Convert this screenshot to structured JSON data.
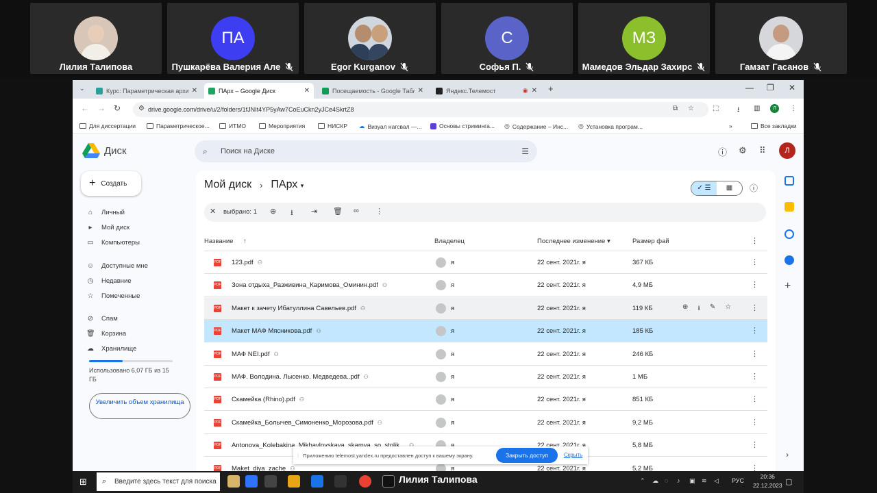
{
  "participants": [
    {
      "name": "Лилия Талипова",
      "muted": false,
      "avatar_type": "photo",
      "avatar_text": ""
    },
    {
      "name": "Пушкарёва Валерия Але",
      "muted": true,
      "avatar_type": "initials",
      "avatar_text": "ПА",
      "avatar_color": "#3d3df2"
    },
    {
      "name": "Egor Kurganov",
      "muted": true,
      "avatar_type": "photo",
      "avatar_text": ""
    },
    {
      "name": "Софья П.",
      "muted": true,
      "avatar_type": "initials",
      "avatar_text": "С",
      "avatar_color": "#5a64c8"
    },
    {
      "name": "Мамедов Эльдар Захирс",
      "muted": true,
      "avatar_type": "initials",
      "avatar_text": "МЗ",
      "avatar_color": "#8bbf2b"
    },
    {
      "name": "Гамзат Гасанов",
      "muted": true,
      "avatar_type": "photo",
      "avatar_text": ""
    }
  ],
  "browser": {
    "tabs": [
      {
        "label": "Курс: Параметрическая архит",
        "icon": "moodle-icon",
        "active": false
      },
      {
        "label": "ПАрх – Google Диск",
        "icon": "drive-icon",
        "active": true
      },
      {
        "label": "Посещаемость - Google Табл",
        "icon": "sheets-icon",
        "active": false
      },
      {
        "label": "Яндекс.Телемост",
        "icon": "telemost-icon",
        "active": false
      }
    ],
    "url": "drive.google.com/drive/u/2/folders/1fJNIt4YP5yAw7CoEuCkn2yJCe4SkrtZ8",
    "bookmarks": [
      "Для диссертации",
      "Параметрическое...",
      "ИТМО",
      "Мероприятия",
      "НИСКР",
      "Визуал нагсвал —...",
      "Основы стриминга...",
      "Содержание – Инс...",
      "Установка програм..."
    ],
    "all_bookmarks": "Все закладки"
  },
  "drive": {
    "app_name": "Диск",
    "search_placeholder": "Поиск на Диске",
    "user_initial": "Л",
    "create_label": "Создать",
    "sidebar": [
      {
        "label": "Личный",
        "icon": "home-icon"
      },
      {
        "label": "Мой диск",
        "icon": "drive-folder-icon"
      },
      {
        "label": "Компьютеры",
        "icon": "computer-icon"
      },
      {
        "label": "Доступные мне",
        "icon": "people-icon"
      },
      {
        "label": "Недавние",
        "icon": "clock-icon"
      },
      {
        "label": "Помеченные",
        "icon": "star-icon"
      },
      {
        "label": "Спам",
        "icon": "spam-icon"
      },
      {
        "label": "Корзина",
        "icon": "trash-icon"
      },
      {
        "label": "Хранилище",
        "icon": "cloud-icon"
      }
    ],
    "storage_text": "Использовано 6,07 ГБ из 15 ГБ",
    "storage_used_fraction": 0.4,
    "upgrade_label": "Увеличить объем хранилища",
    "breadcrumb": {
      "root": "Мой диск",
      "current": "ПАрх"
    },
    "selection_text": "выбрано: 1",
    "columns": {
      "name": "Название",
      "owner": "Владелец",
      "modified": "Последнее изменение",
      "size": "Размер фай"
    },
    "files": [
      {
        "name": "123.pdf",
        "owner": "я",
        "modified": "22 сент. 2021г. я",
        "size": "367 КБ",
        "state": "normal"
      },
      {
        "name": "Зона отдыха_Разживина_Каримова_Оминин.pdf",
        "owner": "я",
        "modified": "22 сент. 2021г. я",
        "size": "4,9 МБ",
        "state": "normal"
      },
      {
        "name": "Макет к зачету Ибатуллина Савельев.pdf",
        "owner": "я",
        "modified": "22 сент. 2021г. я",
        "size": "119 КБ",
        "state": "hover"
      },
      {
        "name": "Макет МАФ Мясникова.pdf",
        "owner": "я",
        "modified": "22 сент. 2021г. я",
        "size": "185 КБ",
        "state": "selected"
      },
      {
        "name": "МАФ NEI.pdf",
        "owner": "я",
        "modified": "22 сент. 2021г. я",
        "size": "246 КБ",
        "state": "normal"
      },
      {
        "name": "МАФ. Володина. Лысенко. Медведева..pdf",
        "owner": "я",
        "modified": "22 сент. 2021г. я",
        "size": "1 МБ",
        "state": "normal"
      },
      {
        "name": "Скамейка (Rhino).pdf",
        "owner": "я",
        "modified": "22 сент. 2021г. я",
        "size": "851 КБ",
        "state": "normal"
      },
      {
        "name": "Скамейка_Болычев_Симоненко_Морозова.pdf",
        "owner": "я",
        "modified": "22 сент. 2021г. я",
        "size": "9,2 МБ",
        "state": "normal"
      },
      {
        "name": "Antonova_Kolebakina_Mikhaylovskaya_skamya_so_stolik...",
        "owner": "я",
        "modified": "22 сент. 2021г. я",
        "size": "5,8 МБ",
        "state": "normal"
      },
      {
        "name": "Maket_diya_zache",
        "owner": "я",
        "modified": "22 сент. 2021г. я",
        "size": "5,2 МБ",
        "state": "normal"
      }
    ],
    "access_notice": "Приложению telemost.yandex.ru предоставлен доступ к вашему экрану.",
    "access_close": "Закрыть доступ",
    "access_hide": "Скрыть"
  },
  "taskbar": {
    "search_placeholder": "Введите здесь текст для поиска",
    "speaker": "Лилия Талипова",
    "lang": "РУС",
    "time": "20:36",
    "date": "22.12.2023"
  }
}
